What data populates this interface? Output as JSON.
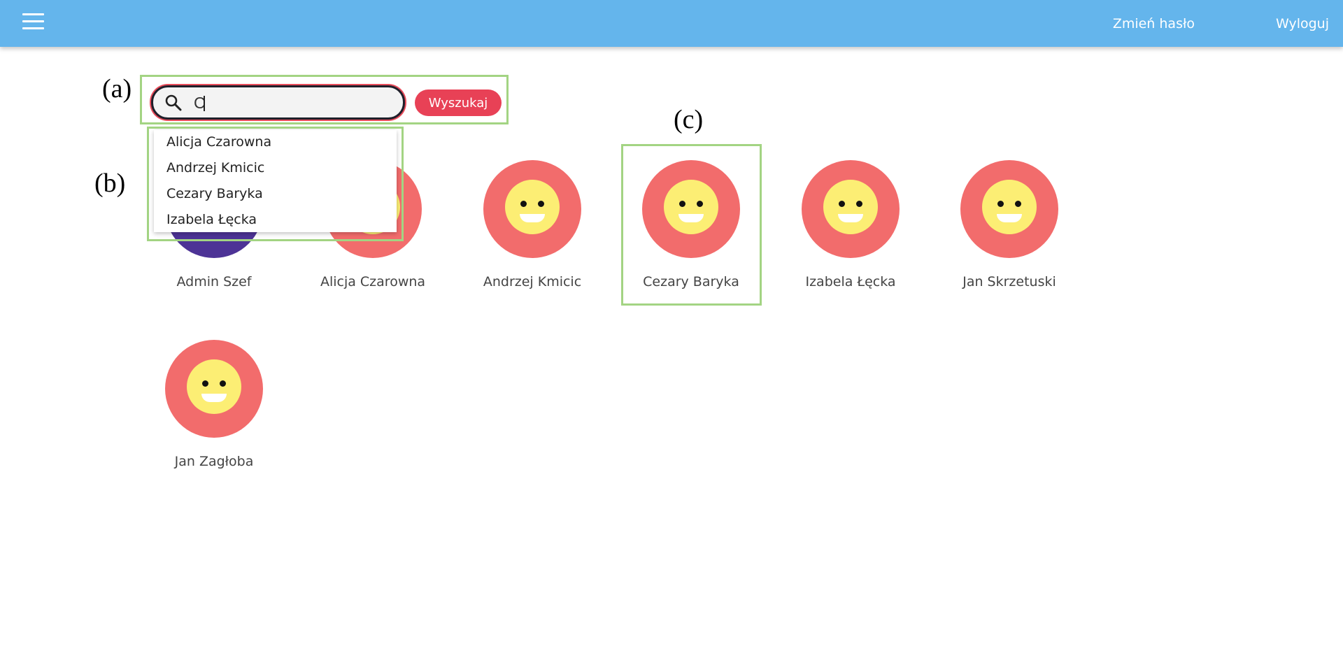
{
  "header": {
    "menu_icon": "hamburger-menu-icon",
    "links": {
      "change_password": "Zmień hasło",
      "logout": "Wyloguj"
    },
    "color": "#64b5ec"
  },
  "annotations": {
    "a": "(a)",
    "b": "(b)",
    "c": "(c)"
  },
  "search": {
    "icon": "search-icon",
    "value": "C",
    "placeholder": "",
    "button_label": "Wyszukaj",
    "button_color": "#e84156"
  },
  "autocomplete": {
    "items": [
      "Alicja Czarowna",
      "Andrzej Kmicic",
      "Cezary Baryka",
      "Izabela Łęcka"
    ]
  },
  "users": [
    {
      "name": "Admin Szef",
      "avatar": "admin-photo"
    },
    {
      "name": "Alicja Czarowna",
      "avatar": "smiley-avatar"
    },
    {
      "name": "Andrzej Kmicic",
      "avatar": "smiley-avatar"
    },
    {
      "name": "Cezary Baryka",
      "avatar": "smiley-avatar"
    },
    {
      "name": "Izabela Łęcka",
      "avatar": "smiley-avatar"
    },
    {
      "name": "Jan Skrzetuski",
      "avatar": "smiley-avatar"
    },
    {
      "name": "Jan Zagłoba",
      "avatar": "smiley-avatar"
    }
  ]
}
